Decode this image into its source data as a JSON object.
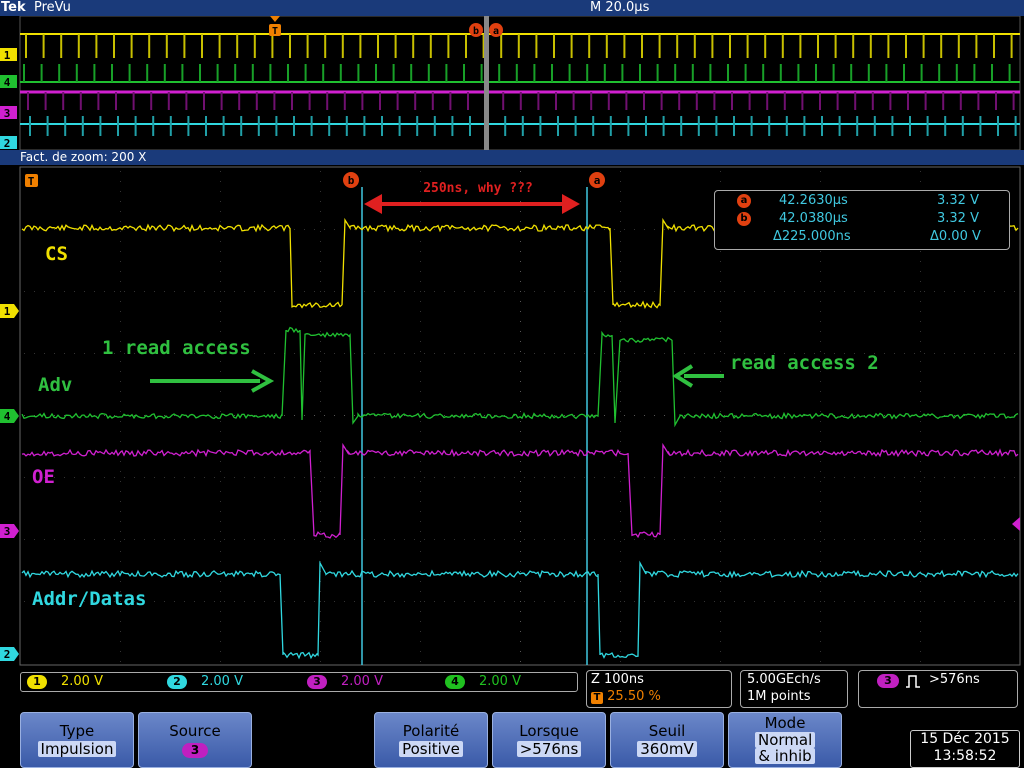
{
  "header": {
    "logo": "Tek",
    "mode": "PreVu",
    "timebase": "M 20.0µs"
  },
  "zoom": {
    "label": "Fact. de zoom: 200 X"
  },
  "markers": {
    "trigger": "T",
    "cursor_a": "a",
    "cursor_b": "b"
  },
  "annotations": {
    "interval": "250ns, why ???",
    "access1": "1 read access",
    "access2": "read access 2"
  },
  "traces": {
    "cs": "CS",
    "adv": "Adv",
    "oe": "OE",
    "addr": "Addr/Datas"
  },
  "channel_markers": [
    "1",
    "4",
    "3",
    "2"
  ],
  "cursor_readout": {
    "a_time": "42.2630µs",
    "a_volt": "3.32 V",
    "b_time": "42.0380µs",
    "b_volt": "3.32 V",
    "delta_time": "Δ225.000ns",
    "delta_volt": "Δ0.00 V"
  },
  "channels": [
    {
      "num": "1",
      "scale": "2.00 V",
      "color": "#f0e000"
    },
    {
      "num": "2",
      "scale": "2.00 V",
      "color": "#30d8e0"
    },
    {
      "num": "3",
      "scale": "2.00 V",
      "color": "#c020c0"
    },
    {
      "num": "4",
      "scale": "2.00 V",
      "color": "#20c020"
    }
  ],
  "zoom_info": {
    "scale": "Z 100ns",
    "trigger_pos": "25.50 %",
    "trigger_label": "T"
  },
  "acq": {
    "rate": "5.00GEch/s",
    "points": "1M points"
  },
  "trigger_info": {
    "source": "3",
    "condition": ">576ns"
  },
  "softkeys": [
    {
      "title": "Type",
      "value": "Impulsion"
    },
    {
      "title": "Source",
      "value": "3"
    },
    {
      "title": "Polarité",
      "value": "Positive"
    },
    {
      "title": "Lorsque",
      "value": ">576ns"
    },
    {
      "title": "Seuil",
      "value": "360mV"
    },
    {
      "title": "Mode",
      "value1": "Normal",
      "value2": "& inhib"
    }
  ],
  "datetime": {
    "date": "15 Déc 2015",
    "time": "13:58:52"
  },
  "colors": {
    "ch1": "#f0e000",
    "ch2": "#30d8e0",
    "ch3": "#d020d0",
    "ch4": "#20c030",
    "annotation_red": "#e02020",
    "annotation_green": "#30c040",
    "header_blue": "#1a3a7a"
  }
}
